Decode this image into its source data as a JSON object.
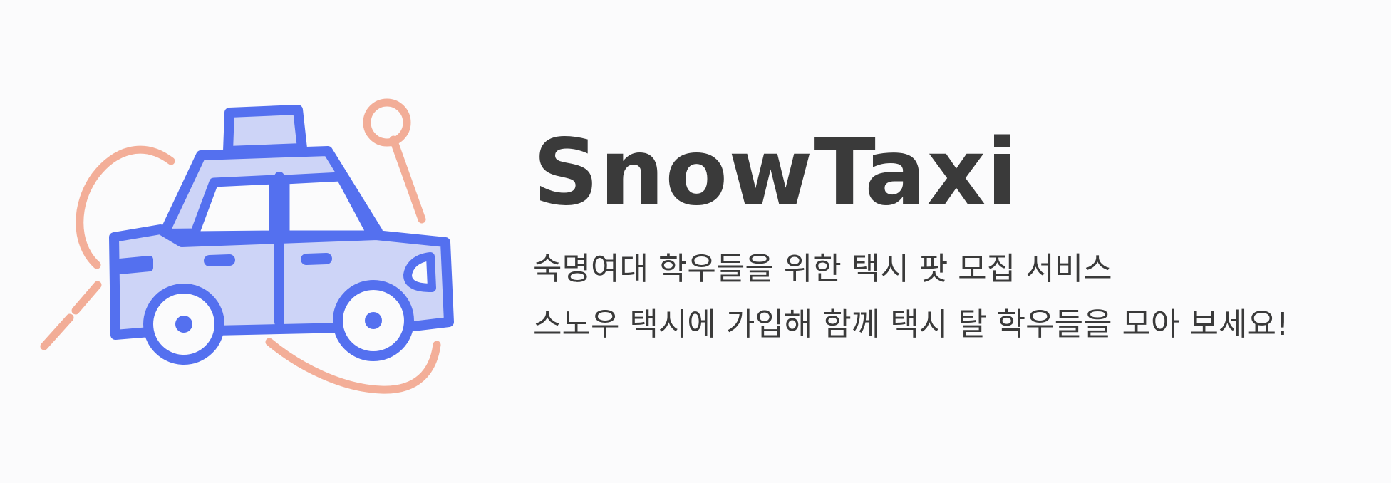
{
  "brand": {
    "title": "SnowTaxi"
  },
  "tagline": {
    "line1": "숙명여대 학우들을 위한 택시 팟 모집 서비스",
    "line2": "스노우 택시에 가입해 함께 택시 탈 학우들을 모아 보세요!"
  },
  "colors": {
    "background": "#fbfbfc",
    "taxi_stroke": "#5470ef",
    "taxi_fill": "#cdd4f7",
    "accent_lines": "#f2a58d",
    "text": "#3a3a3a"
  },
  "icons": {
    "main": "taxi-icon",
    "decor": "map-pin-icon"
  }
}
